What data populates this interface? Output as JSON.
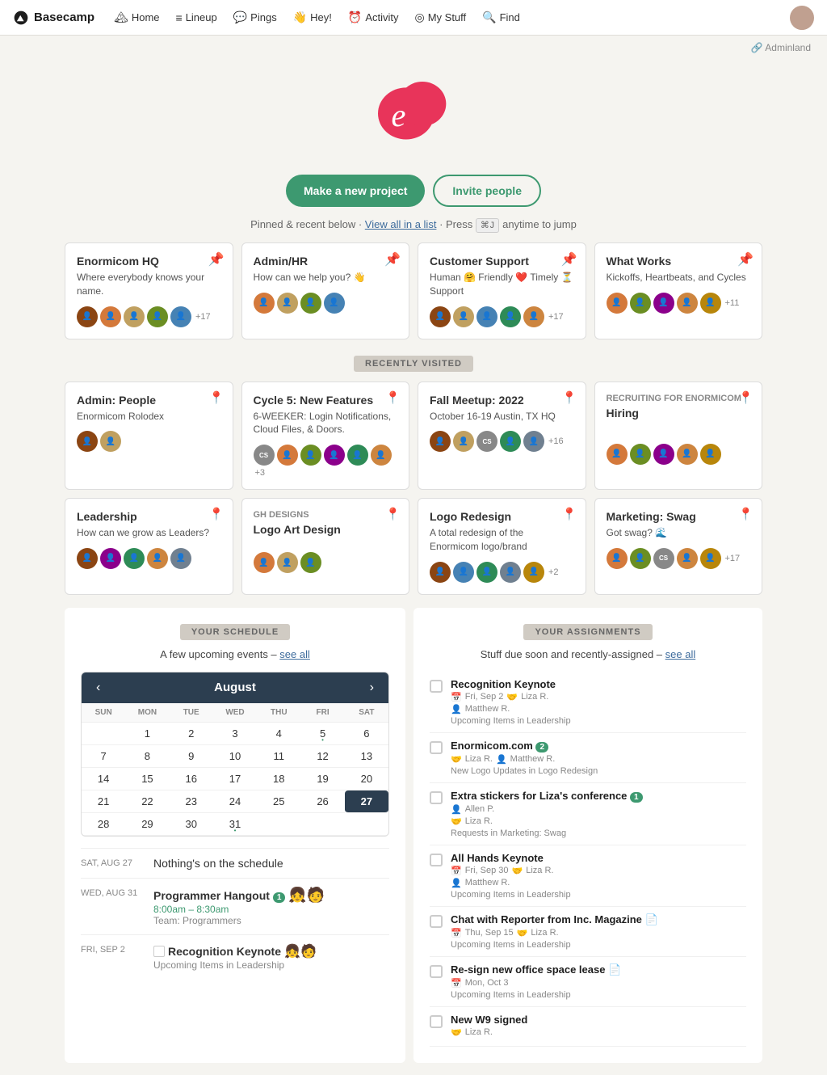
{
  "nav": {
    "logo": "Basecamp",
    "items": [
      {
        "label": "Home",
        "icon": "🏔"
      },
      {
        "label": "Lineup",
        "icon": "≡"
      },
      {
        "label": "Pings",
        "icon": "💬"
      },
      {
        "label": "Hey!",
        "icon": "👋"
      },
      {
        "label": "Activity",
        "icon": "⏰"
      },
      {
        "label": "My Stuff",
        "icon": "◎"
      },
      {
        "label": "Find",
        "icon": "🔍"
      }
    ],
    "adminland_label": "🔗 Adminland"
  },
  "hero": {
    "make_project_label": "Make a new project",
    "invite_people_label": "Invite people",
    "hint_text": "Pinned & recent below ·",
    "view_all_label": "View all in a list",
    "hint_mid": "· Press",
    "kbd": "⌘J",
    "hint_end": "anytime to jump"
  },
  "pinned_cards": [
    {
      "title": "Enormicom HQ",
      "desc": "Where everybody knows your name.",
      "pinned": true,
      "avatars": [
        "av1",
        "av2",
        "av3",
        "av4",
        "av5",
        "av6"
      ],
      "extra": "+17"
    },
    {
      "title": "Admin/HR",
      "desc": "How can we help you? 👋",
      "pinned": true,
      "avatars": [
        "av2",
        "av3",
        "av4",
        "av5"
      ],
      "extra": ""
    },
    {
      "title": "Customer Support",
      "desc": "Human 🤗 Friendly ❤️ Timely ⏳ Support",
      "pinned": true,
      "avatars": [
        "av1",
        "av3",
        "av5",
        "av7",
        "av8",
        "av9"
      ],
      "extra": "+17"
    },
    {
      "title": "What Works",
      "desc": "Kickoffs, Heartbeats, and Cycles",
      "pinned": true,
      "avatars": [
        "av2",
        "av4",
        "av6",
        "av8",
        "av10"
      ],
      "extra": "+11"
    }
  ],
  "recently_visited_label": "RECENTLY VISITED",
  "recent_cards": [
    {
      "title": "Admin: People",
      "subtitle": "",
      "desc": "Enormicom Rolodex",
      "pinned": false,
      "avatars": [
        "av1",
        "av3"
      ],
      "extra": ""
    },
    {
      "title": "Cycle 5: New Features",
      "subtitle": "",
      "desc": "6-WEEKER: Login Notifications, Cloud Files, & Doors.",
      "pinned": false,
      "avatars": [
        "av5",
        "av2",
        "av4",
        "av6",
        "av7",
        "av8"
      ],
      "extra": "+3"
    },
    {
      "title": "Fall Meetup: 2022",
      "subtitle": "",
      "desc": "October 16-19 Austin, TX HQ",
      "pinned": false,
      "avatars": [
        "av1",
        "av3",
        "av5",
        "av7",
        "av9"
      ],
      "extra": "+16"
    },
    {
      "title": "Hiring",
      "subtitle": "RECRUITING FOR ENORMICOM",
      "desc": "",
      "pinned": false,
      "avatars": [
        "av2",
        "av4",
        "av6",
        "av8",
        "av10"
      ],
      "extra": ""
    },
    {
      "title": "Leadership",
      "subtitle": "",
      "desc": "How can we grow as Leaders?",
      "pinned": false,
      "avatars": [
        "av1",
        "av6",
        "av7",
        "av8",
        "av9"
      ],
      "extra": ""
    },
    {
      "title": "Logo Art Design",
      "subtitle": "GH DESIGNS",
      "desc": "",
      "pinned": false,
      "avatars": [
        "av2",
        "av3",
        "av4"
      ],
      "extra": ""
    },
    {
      "title": "Logo Redesign",
      "subtitle": "",
      "desc": "A total redesign of the Enormicom logo/brand",
      "pinned": false,
      "avatars": [
        "av1",
        "av5",
        "av7",
        "av9",
        "av10"
      ],
      "extra": "+2"
    },
    {
      "title": "Marketing: Swag",
      "subtitle": "",
      "desc": "Got swag? 🌊",
      "pinned": false,
      "avatars": [
        "av2",
        "av4",
        "av6",
        "av8",
        "av10"
      ],
      "extra": "+17"
    }
  ],
  "schedule": {
    "title": "YOUR SCHEDULE",
    "subtitle": "A few upcoming events –",
    "see_all": "see all",
    "calendar": {
      "month": "August",
      "days_header": [
        "SUN",
        "MON",
        "TUE",
        "WED",
        "THU",
        "FRI",
        "SAT"
      ],
      "weeks": [
        [
          null,
          1,
          2,
          3,
          4,
          5,
          6
        ],
        [
          7,
          8,
          9,
          10,
          11,
          12,
          13
        ],
        [
          14,
          15,
          16,
          17,
          18,
          19,
          20
        ],
        [
          21,
          22,
          23,
          24,
          25,
          26,
          27
        ],
        [
          28,
          29,
          30,
          31,
          null,
          null,
          null
        ]
      ],
      "today": 27,
      "has_dot": [
        5,
        27,
        31
      ]
    },
    "events": [
      {
        "date": "SAT, AUG 27",
        "title": "Nothing's on the schedule",
        "time": "",
        "sub": ""
      },
      {
        "date": "WED, AUG 31",
        "title": "Programmer Hangout",
        "badge": "1",
        "time": "8:00am – 8:30am",
        "sub": "Team: Programmers"
      },
      {
        "date": "FRI, SEP 2",
        "title": "Recognition Keynote",
        "time": "",
        "sub": "Upcoming Items in Leadership"
      }
    ]
  },
  "assignments": {
    "title": "YOUR ASSIGNMENTS",
    "subtitle": "Stuff due soon and recently-assigned –",
    "see_all": "see all",
    "items": [
      {
        "title": "Recognition Keynote",
        "date_icon": "📅",
        "date": "Fri, Sep 2",
        "assignees": "🤝 Liza R.",
        "sub_assignees": "Matthew R.",
        "project": "Upcoming Items in Leadership"
      },
      {
        "title": "Enormicom.com",
        "badge": "2",
        "date_icon": "",
        "date": "",
        "assignees": "🤝 Liza R.  Matthew R.",
        "sub_assignees": "",
        "project": "New Logo Updates in Logo Redesign"
      },
      {
        "title": "Extra stickers for Liza's conference",
        "badge": "1",
        "date_icon": "",
        "date": "",
        "assignees": "👤 Allen P.",
        "sub_assignees": "🤝 Liza R.",
        "project": "Requests in Marketing: Swag"
      },
      {
        "title": "All Hands Keynote",
        "date_icon": "📅",
        "date": "Fri, Sep 30",
        "assignees": "🤝 Liza R.",
        "sub_assignees": "Matthew R.",
        "project": "Upcoming Items in Leadership"
      },
      {
        "title": "Chat with Reporter from Inc. Magazine",
        "icon": "📄",
        "date_icon": "📅",
        "date": "Thu, Sep 15",
        "assignees": "🤝 Liza R.",
        "sub_assignees": "",
        "project": "Upcoming Items in Leadership"
      },
      {
        "title": "Re-sign new office space lease",
        "icon": "📄",
        "date_icon": "📅",
        "date": "Mon, Oct 3",
        "assignees": "",
        "sub_assignees": "",
        "project": "Upcoming Items in Leadership"
      },
      {
        "title": "New W9 signed",
        "date_icon": "",
        "date": "",
        "assignees": "🤝 Liza R.",
        "sub_assignees": "",
        "project": ""
      }
    ]
  }
}
